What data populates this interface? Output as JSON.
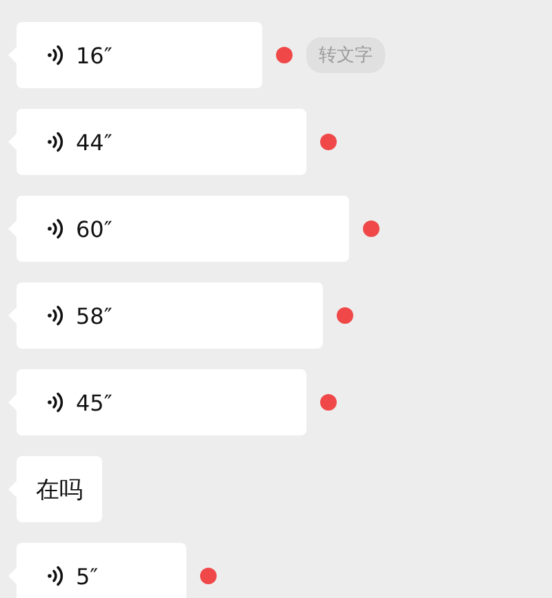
{
  "messages": [
    {
      "kind": "voice",
      "duration": "16″",
      "unread": true,
      "transcribe_button": "转文字"
    },
    {
      "kind": "voice",
      "duration": "44″",
      "unread": true
    },
    {
      "kind": "voice",
      "duration": "60″",
      "unread": true
    },
    {
      "kind": "voice",
      "duration": "58″",
      "unread": true
    },
    {
      "kind": "voice",
      "duration": "45″",
      "unread": true
    },
    {
      "kind": "text",
      "text": "在吗"
    },
    {
      "kind": "voice",
      "duration": "5″",
      "unread": true
    }
  ]
}
